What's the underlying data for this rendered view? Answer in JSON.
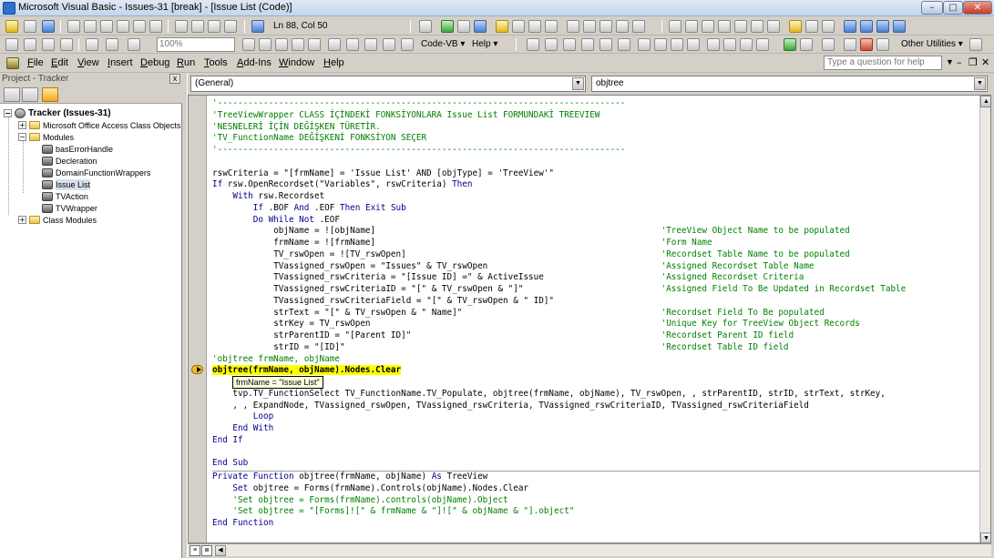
{
  "window": {
    "title": "Microsoft Visual Basic - Issues-31 [break] - [Issue List (Code)]",
    "min_glyph": "–",
    "max_glyph": "□",
    "close_glyph": "✕"
  },
  "toolbar": {
    "cursor_pos": "Ln 88, Col 50",
    "zoom": "100%",
    "code_vb_label": "Code-VB ▾",
    "help_label": "Help ▾",
    "other_utilities_label": "Other Utilities ▾"
  },
  "menu": {
    "items": [
      {
        "pre": "",
        "u": "F",
        "post": "ile"
      },
      {
        "pre": "",
        "u": "E",
        "post": "dit"
      },
      {
        "pre": "",
        "u": "V",
        "post": "iew"
      },
      {
        "pre": "",
        "u": "I",
        "post": "nsert"
      },
      {
        "pre": "",
        "u": "D",
        "post": "ebug"
      },
      {
        "pre": "",
        "u": "R",
        "post": "un"
      },
      {
        "pre": "",
        "u": "T",
        "post": "ools"
      },
      {
        "pre": "",
        "u": "A",
        "post": "dd-Ins"
      },
      {
        "pre": "",
        "u": "W",
        "post": "indow"
      },
      {
        "pre": "",
        "u": "H",
        "post": "elp"
      }
    ],
    "help_placeholder": "Type a question for help"
  },
  "project": {
    "title": "Project - Tracker",
    "close_glyph": "x",
    "tree": {
      "root": "Tracker (Issues-31)",
      "folders": [
        "Microsoft Office Access Class Objects",
        "Modules",
        "Class Modules"
      ],
      "modules": [
        "basErrorHandle",
        "Decleration",
        "DomainFunctionWrappers",
        "Issue List",
        "TVAction",
        "TVWrapper"
      ],
      "selected_module": "Issue List"
    }
  },
  "code": {
    "object_combo": "(General)",
    "procedure_combo": "objtree",
    "tooltip": "frmName = \"Issue List\"",
    "lines": [
      {
        "i": 0,
        "t": "'--------------------------------------------------------------------------------",
        "type": "c"
      },
      {
        "i": 0,
        "t": "'TreeViewWrapper CLASS İÇİNDEKİ FONKSİYONLARA Issue List FORMUNDAKİ TREEVIEW",
        "type": "c"
      },
      {
        "i": 0,
        "t": "'NESNELERİ İÇİN DEĞİŞKEN TÜRETİR.",
        "type": "c"
      },
      {
        "i": 0,
        "t": "'TV_FunctionName DEĞİŞKENİ FONKSİYON SEÇER",
        "type": "c"
      },
      {
        "i": 0,
        "t": "'--------------------------------------------------------------------------------",
        "type": "c"
      },
      {
        "i": 0,
        "t": "",
        "type": "n"
      },
      {
        "i": 0,
        "t": "rswCriteria = \"[frmName] = 'Issue List' AND [objType] = 'TreeView'\"",
        "type": "n"
      },
      {
        "i": 0,
        "k": "If ",
        "t": "rsw.OpenRecordset(\"Variables\", rswCriteria) ",
        "k2": "Then",
        "type": "kw"
      },
      {
        "i": 4,
        "k": "With ",
        "t": "rsw.Recordset",
        "type": "kw"
      },
      {
        "i": 8,
        "k": "If ",
        "t": ".BOF ",
        "k2": "And",
        "t2": " .EOF ",
        "k3": "Then Exit Sub",
        "type": "kw3"
      },
      {
        "i": 8,
        "k": "Do While Not ",
        "t": ".EOF",
        "type": "kw"
      },
      {
        "i": 12,
        "t": "objName = ![objName]",
        "cm": "'TreeView Object Name to be populated",
        "type": "cm"
      },
      {
        "i": 12,
        "t": "frmName = ![frmName]",
        "cm": "'Form Name",
        "type": "cm"
      },
      {
        "i": 12,
        "t": "TV_rswOpen = ![TV_rswOpen]",
        "cm": "'Recordset Table Name to be populated",
        "type": "cm"
      },
      {
        "i": 12,
        "t": "TVassigned_rswOpen = \"Issues\" & TV_rswOpen",
        "cm": "'Assigned Recordset Table Name",
        "type": "cm"
      },
      {
        "i": 12,
        "t": "TVassigned_rswCriteria = \"[Issue ID] =\" & ActiveIssue",
        "cm": "'Assigned Recordset Criteria",
        "type": "cm"
      },
      {
        "i": 12,
        "t": "TVassigned_rswCriteriaID = \"[\" & TV_rswOpen & \"]\"",
        "cm": "'Assigned Field To Be Updated in Recordset Table",
        "type": "cm"
      },
      {
        "i": 12,
        "t": "TVassigned_rswCriteriaField = \"[\" & TV_rswOpen & \" ID]\"",
        "type": "n"
      },
      {
        "i": 12,
        "t": "strText = \"[\" & TV_rswOpen & \" Name]\"",
        "cm": "'Recordset Field To Be populated",
        "type": "cm"
      },
      {
        "i": 12,
        "t": "strKey = TV_rswOpen",
        "cm": "'Unique Key for TreeView Object Records",
        "type": "cm"
      },
      {
        "i": 12,
        "t": "strParentID = \"[Parent ID]\"",
        "cm": "'Recordset Parent ID field",
        "type": "cm"
      },
      {
        "i": 12,
        "t": "strID = \"[ID]\"",
        "cm": "'Recordset Table ID field",
        "type": "cm"
      },
      {
        "i": 0,
        "t": "'objtree frmName, objName",
        "type": "c"
      },
      {
        "i": 0,
        "t": "objtree(frmName, objName).Nodes.Clear",
        "type": "hl"
      },
      {
        "i": 0,
        "t": "",
        "type": "n"
      },
      {
        "i": 4,
        "t": "tvp.TV_FunctionSelect TV_FunctionName.TV_Populate, objtree(frmName, objName), TV_rswOpen, , strParentID, strID, strText, strKey,",
        "type": "n"
      },
      {
        "i": 4,
        "t": ", , ExpandNode, TVassigned_rswOpen, TVassigned_rswCriteria, TVassigned_rswCriteriaID, TVassigned_rswCriteriaField",
        "type": "n"
      },
      {
        "i": 8,
        "k": "Loop",
        "t": "",
        "type": "kw"
      },
      {
        "i": 4,
        "k": "End With",
        "t": "",
        "type": "kw"
      },
      {
        "i": 0,
        "k": "End If",
        "t": "",
        "type": "kw"
      },
      {
        "i": 0,
        "t": "",
        "type": "n"
      },
      {
        "i": 0,
        "k": "End Sub",
        "t": "",
        "type": "kw"
      },
      {
        "i": 0,
        "k": "Private Function ",
        "t": "objtree(frmName, objName) ",
        "k2": "As",
        "t2": " TreeView",
        "type": "kw2"
      },
      {
        "i": 4,
        "k": "Set ",
        "t": "objtree = Forms(frmName).Controls(objName).Nodes.Clear",
        "type": "kw"
      },
      {
        "i": 4,
        "t": "'Set objtree = Forms(frmName).controls(objName).Object",
        "type": "c"
      },
      {
        "i": 4,
        "t": "'Set objtree = \"[Forms]![\" & frmName & \"]![\" & objName & \"].object\"",
        "type": "c"
      },
      {
        "i": 0,
        "k": "End Function",
        "t": "",
        "type": "kw"
      }
    ]
  },
  "colors": {
    "comment": "#008000",
    "keyword": "#00008b",
    "highlight": "#ffff00"
  }
}
